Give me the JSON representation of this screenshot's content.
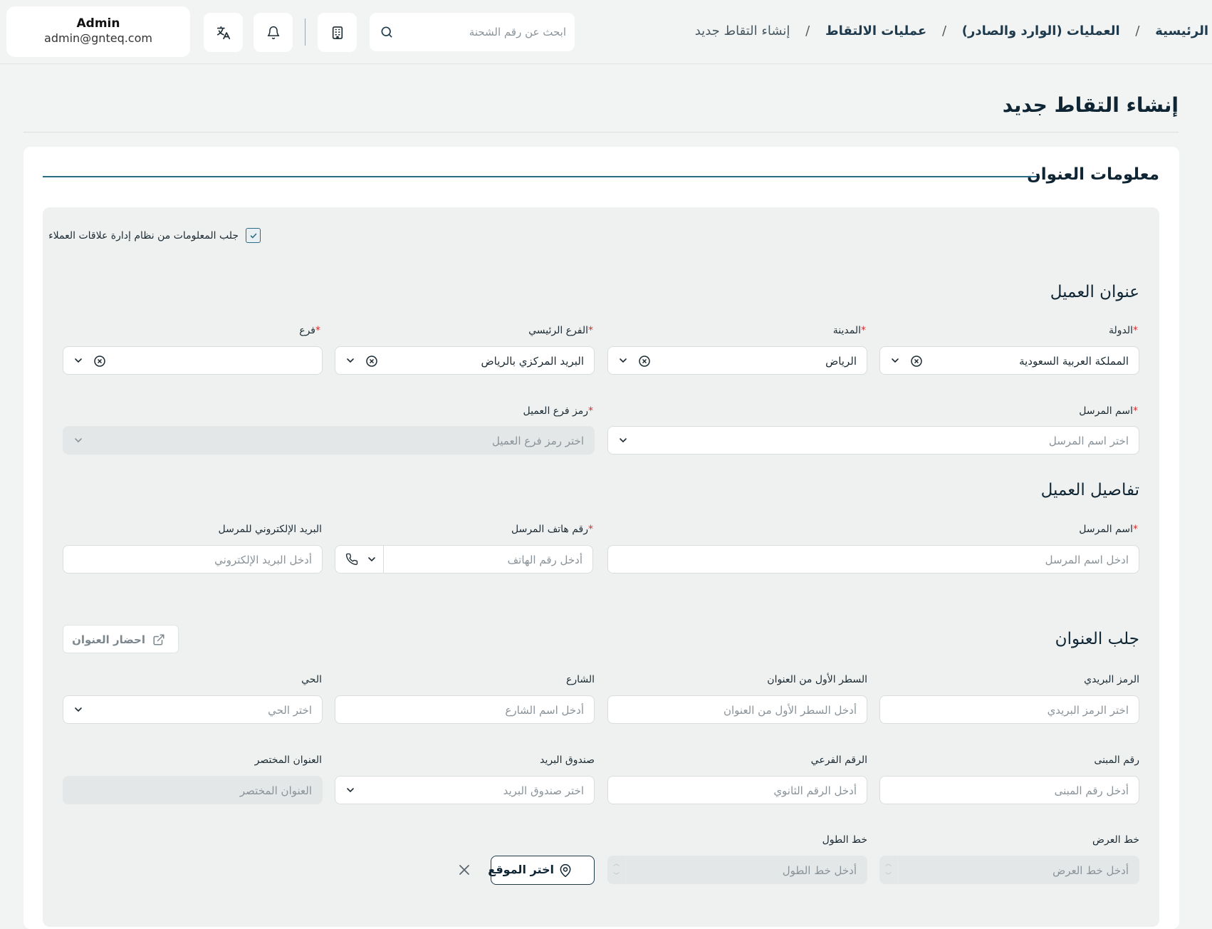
{
  "header": {
    "user_name": "Admin",
    "user_email": "admin@gnteq.com",
    "search_placeholder": "ابحث عن رقم الشحنة",
    "breadcrumb": {
      "home": "الرئيسية",
      "operations": "العمليات (الوارد والصادر)",
      "pickups": "عمليات الالتقاط",
      "current": "إنشاء التقاط جديد",
      "separator": "/"
    },
    "icons": [
      "translate-icon",
      "bell-icon",
      "building-icon",
      "search-icon"
    ]
  },
  "page": {
    "title": "إنشاء التقاط جديد",
    "section_title": "معلومات العنوان",
    "crm_checkbox_label": "جلب المعلومات من نظام إدارة علاقات العملاء",
    "crm_checked": true
  },
  "customer_address": {
    "heading": "عنوان العميل",
    "country_label": "الدولة",
    "country_value": "المملكة العربية السعودية",
    "city_label": "المدينة",
    "city_value": "الرياض",
    "main_branch_label": "الفرع الرئيسي",
    "main_branch_value": "البريد المركزي بالرياض",
    "branch_label": "فرع",
    "branch_value": "",
    "sender_name_label": "اسم المرسل",
    "sender_name_placeholder": "اختر اسم المرسل",
    "branch_code_label": "رمز فرع العميل",
    "branch_code_placeholder": "اختر رمز فرع العميل"
  },
  "customer_details": {
    "heading": "تفاصيل العميل",
    "sender_name_label": "اسم المرسل",
    "sender_name_placeholder": "ادخل اسم المرسل",
    "phone_label": "رقم هاتف المرسل",
    "phone_placeholder": "أدخل رقم الهاتف",
    "email_label": "البريد الإلكتروني للمرسل",
    "email_placeholder": "أدخل البريد الإلكتروني"
  },
  "fetch_address": {
    "heading": "جلب العنوان",
    "fetch_button": "احضار العنوان",
    "postal_label": "الرمز البريدي",
    "postal_placeholder": "اختر الرمز البريدي",
    "line1_label": "السطر الأول من العنوان",
    "line1_placeholder": "أدخل السطر الأول من العنوان",
    "street_label": "الشارع",
    "street_placeholder": "أدخل اسم الشارع",
    "district_label": "الحي",
    "district_placeholder": "اختر الحي",
    "building_label": "رقم المبنى",
    "building_placeholder": "أدخل رقم المبنى",
    "sub_number_label": "الرقم الفرعي",
    "sub_number_placeholder": "أدخل الرقم الثانوي",
    "po_box_label": "صندوق البريد",
    "po_box_placeholder": "اختر صندوق البريد",
    "short_address_label": "العنوان المختصر",
    "short_address_placeholder": "العنوان المختصر",
    "latitude_label": "خط العرض",
    "latitude_placeholder": "أدخل خط العرض",
    "longitude_label": "خط الطول",
    "longitude_placeholder": "أدخل خط الطول",
    "pick_location_button": "اختر الموقع"
  },
  "colors": {
    "accent": "#2a6b86",
    "required": "#d32f2f",
    "dark_text": "#0f2533"
  }
}
